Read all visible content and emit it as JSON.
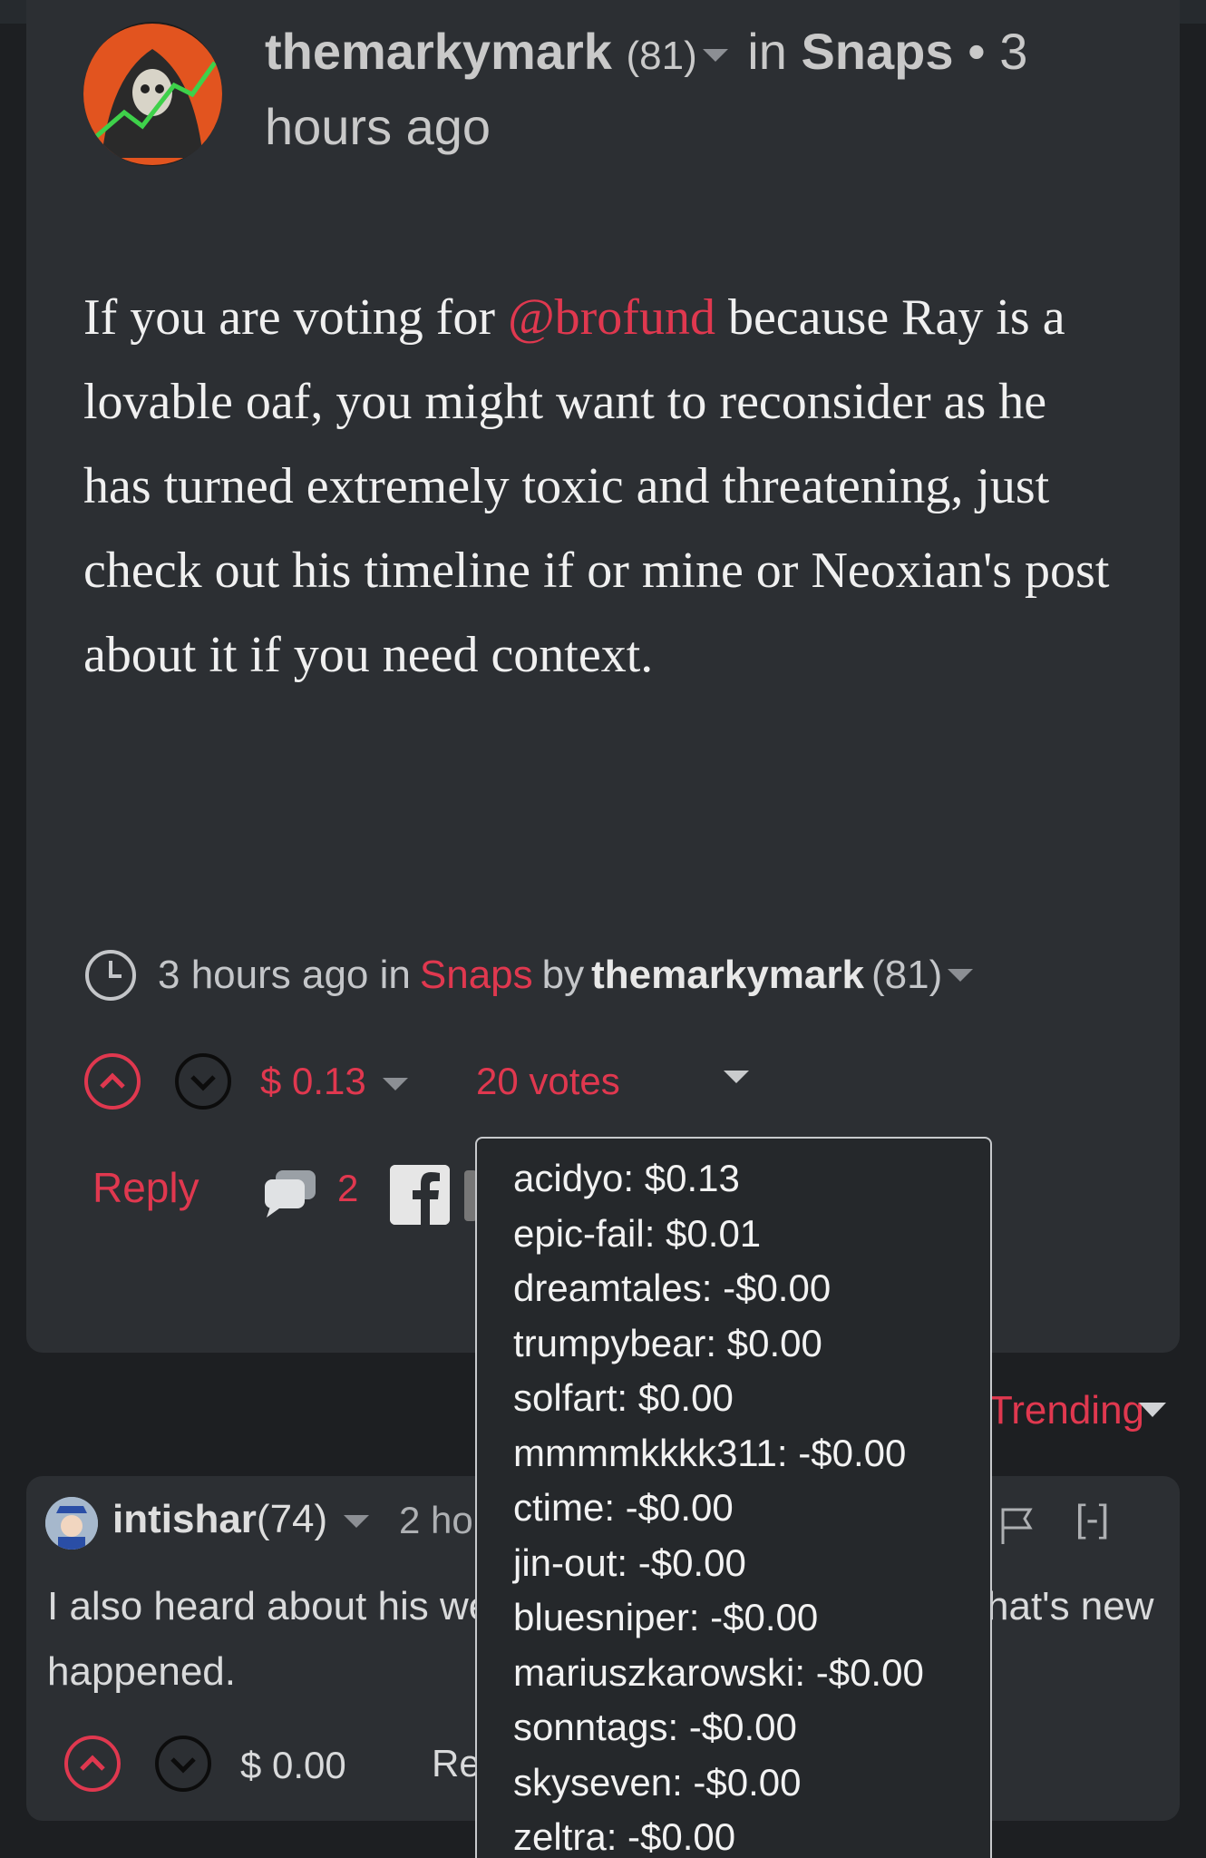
{
  "post": {
    "author": "themarkymark",
    "reputation": "(81)",
    "in_label": "in",
    "category": "Snaps",
    "time_prefix": "• 3",
    "time_suffix": "hours ago",
    "body_before": "If you are voting for",
    "body_mention": "@brofund",
    "body_after": " because Ray is a lovable oaf, you might want to reconsider as he has turned extremely toxic and threatening, just check out his timeline if or mine or Neoxian's post about it if you need context.",
    "meta_time": "3 hours ago in",
    "meta_category": "Snaps",
    "meta_by": "by",
    "meta_author": "themarkymark",
    "meta_rep": "(81)",
    "payout": "$ 0.13",
    "votes": "20 votes",
    "reply_label": "Reply",
    "comment_count": "2"
  },
  "sort_label": "Trending",
  "voters": [
    "acidyo: $0.13",
    "epic-fail: $0.01",
    "dreamtales: -$0.00",
    "trumpybear: $0.00",
    "solfart: $0.00",
    "mmmmkkkk311: -$0.00",
    "ctime: -$0.00",
    "jin-out: -$0.00",
    "bluesniper: -$0.00",
    "mariuszkarowski: -$0.00",
    "sonntags: -$0.00",
    "skyseven: -$0.00",
    "zeltra: -$0.00"
  ],
  "comment": {
    "author": "intishar",
    "reputation": "(74)",
    "time": "2 ho",
    "collapse": "[-]",
    "line1_left": "I also heard about his we",
    "line1_right": "hat's new",
    "line2": "happened.",
    "payout": "$ 0.00",
    "reply_label": "Re"
  },
  "colors": {
    "accent": "#e0384f",
    "card": "#2c2f33",
    "background": "#1d1f22"
  }
}
